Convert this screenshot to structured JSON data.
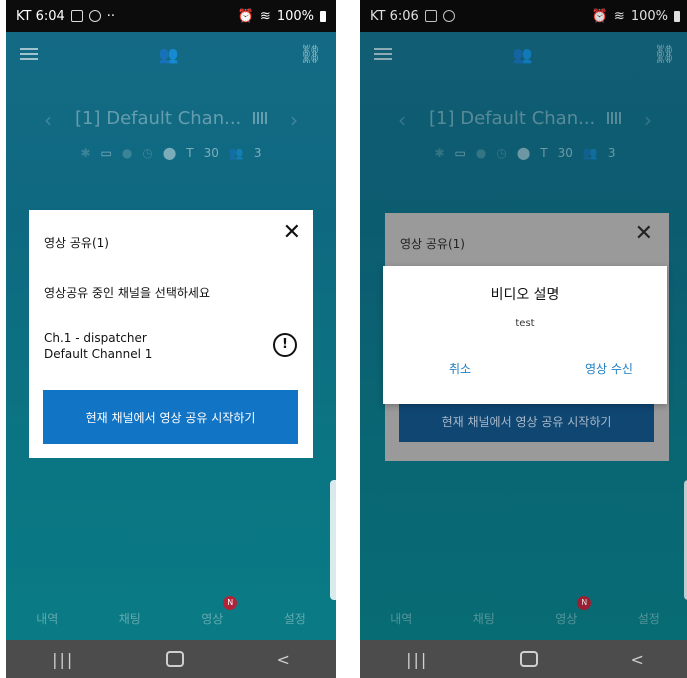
{
  "left": {
    "status": {
      "carrier_time": "KT 6:04",
      "right": "100%"
    },
    "channel_title": "[1] Default Chan...",
    "info": {
      "t_value": "30",
      "users_value": "3"
    },
    "tabs": [
      "내역",
      "채팅",
      "영상",
      "설정"
    ],
    "badge": "N",
    "dialog": {
      "title": "영상 공유(1)",
      "close": "✕",
      "instruction": "영상공유 중인 채널을 선택하세요",
      "channel_line1": "Ch.1 - dispatcher",
      "channel_line2": "Default Channel 1",
      "start_button": "현재 채널에서 영상 공유 시작하기"
    }
  },
  "right": {
    "status": {
      "carrier_time": "KT 6:06",
      "right": "100%"
    },
    "channel_title": "[1] Default Chan...",
    "info": {
      "t_value": "30",
      "users_value": "3"
    },
    "tabs": [
      "내역",
      "채팅",
      "영상",
      "설정"
    ],
    "badge": "N",
    "background_dialog": {
      "title": "영상 공유(1)",
      "close": "✕",
      "start_button": "현재 채널에서 영상 공유 시작하기"
    },
    "video_dialog": {
      "title": "비디오 설명",
      "description": "test",
      "cancel": "취소",
      "receive": "영상 수신"
    }
  },
  "nav": {
    "recent": "|||",
    "back": "<"
  }
}
